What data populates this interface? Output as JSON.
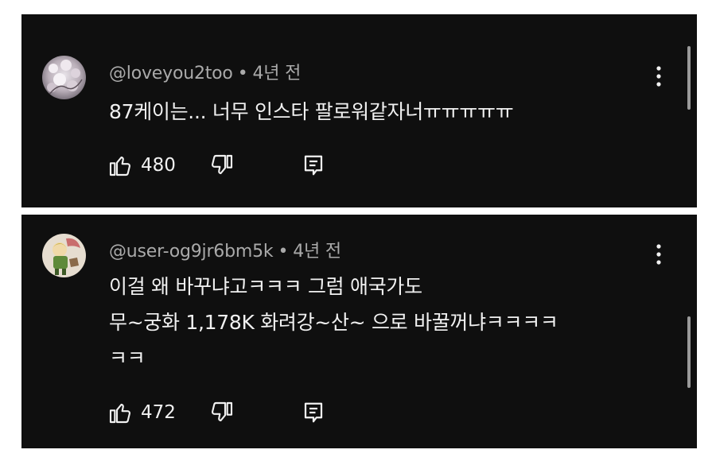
{
  "comments": [
    {
      "username": "@loveyou2too",
      "separator": "•",
      "time": "4년 전",
      "body_lines": [
        "87케이는... 너무 인스타 팔로워같자너ㅠㅠㅠㅠㅠ"
      ],
      "like_count": "480",
      "avatar_icon": "cherry-blossom-avatar"
    },
    {
      "username": "@user-og9jr6bm5k",
      "separator": "•",
      "time": "4년 전",
      "body_lines": [
        "이걸 왜 바꾸냐고ㅋㅋㅋ 그럼 애국가도",
        "무~궁화 1,178K 화려강~산~ 으로 바꿀꺼냐ㅋㅋㅋㅋ",
        "ㅋㅋ"
      ],
      "like_count": "472",
      "avatar_icon": "cartoon-character-avatar"
    }
  ],
  "colors": {
    "card_background": "#0f0f0f",
    "text_primary": "#f1f1f1",
    "text_secondary": "#aaaaaa"
  }
}
